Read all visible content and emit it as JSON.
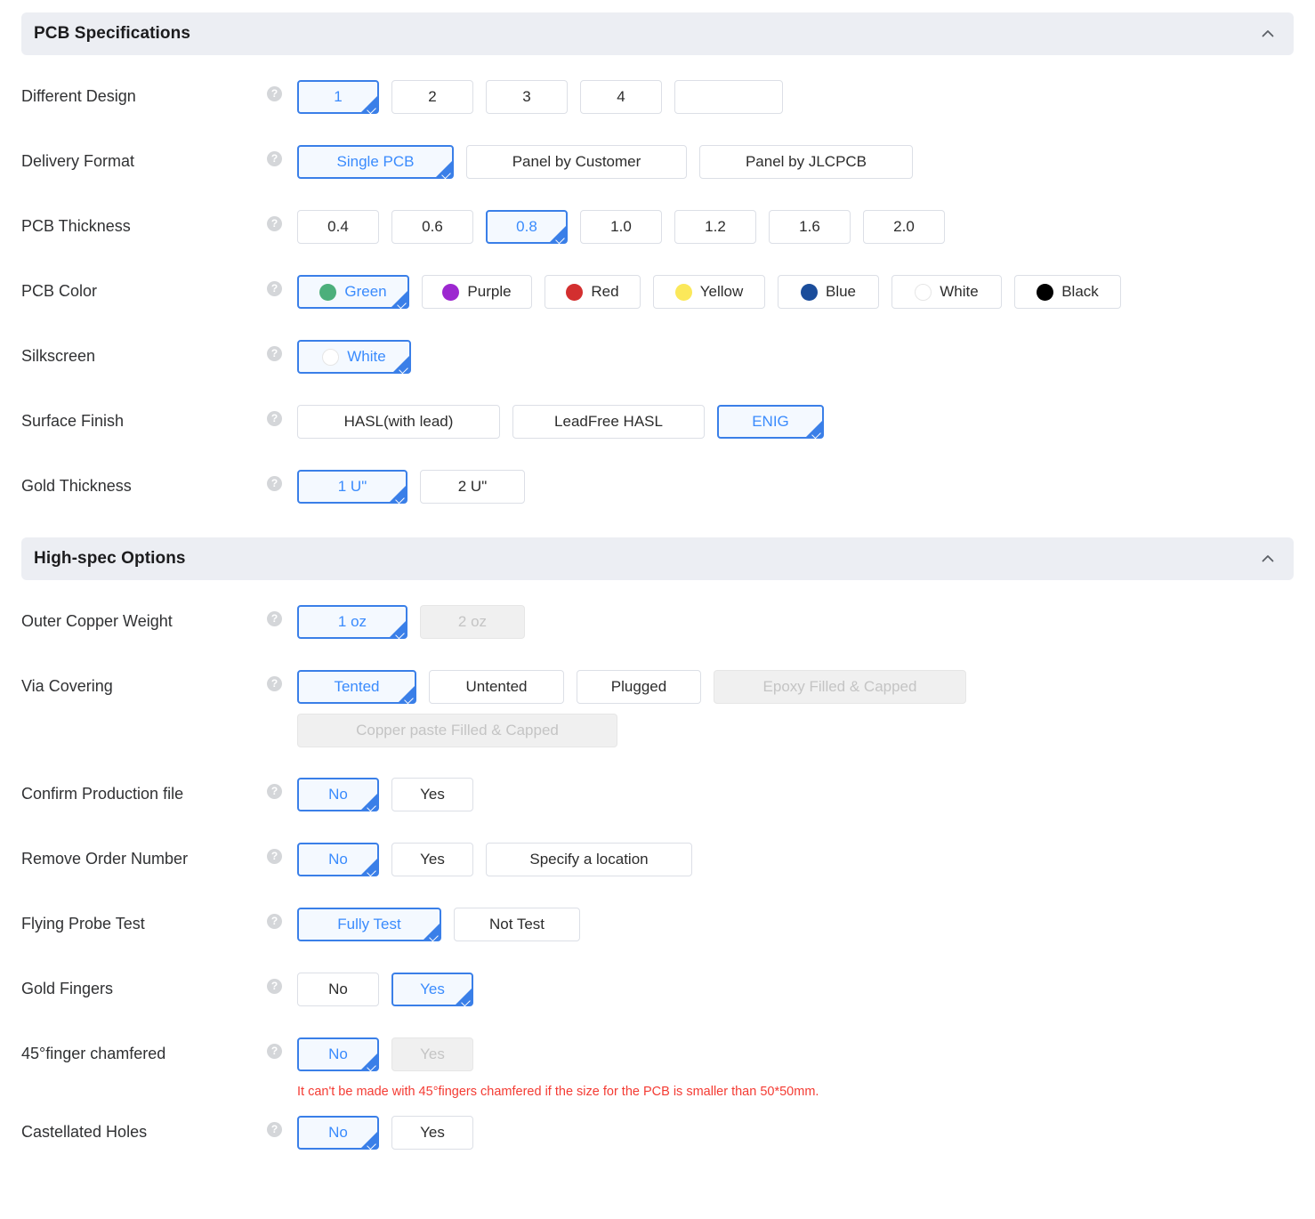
{
  "sections": [
    {
      "title": "PCB Specifications",
      "collapse_icon": "chevron-up-icon"
    },
    {
      "title": "High-spec Options",
      "collapse_icon": "chevron-up-icon"
    }
  ],
  "help_icon_glyph": "?",
  "colors": {
    "accent": "#3a8bfd",
    "accent_border": "#3a7fe8",
    "selected_bg": "#f4f9ff",
    "header_bg": "#eceef3",
    "warning": "#f43b33",
    "disabled_bg": "#f0f0f0",
    "disabled_text": "#c4c4c4",
    "swatch_green": "#4caf7b",
    "swatch_purple": "#9c27d0",
    "swatch_red": "#d32f2f",
    "swatch_yellow": "#fbe85a",
    "swatch_blue": "#1b4d9b",
    "swatch_white": "#ffffff",
    "swatch_black": "#000000"
  },
  "pcb_specifications": {
    "different_design": {
      "label": "Different Design",
      "options": [
        "1",
        "2",
        "3",
        "4"
      ],
      "selected": "1",
      "custom_input_value": "",
      "custom_input_placeholder": ""
    },
    "delivery_format": {
      "label": "Delivery Format",
      "options": [
        "Single PCB",
        "Panel by Customer",
        "Panel by JLCPCB"
      ],
      "selected": "Single PCB"
    },
    "pcb_thickness": {
      "label": "PCB Thickness",
      "options": [
        "0.4",
        "0.6",
        "0.8",
        "1.0",
        "1.2",
        "1.6",
        "2.0"
      ],
      "selected": "0.8"
    },
    "pcb_color": {
      "label": "PCB Color",
      "options": [
        {
          "label": "Green",
          "swatch": "#4caf7b"
        },
        {
          "label": "Purple",
          "swatch": "#9c27d0"
        },
        {
          "label": "Red",
          "swatch": "#d32f2f"
        },
        {
          "label": "Yellow",
          "swatch": "#fbe85a"
        },
        {
          "label": "Blue",
          "swatch": "#1b4d9b"
        },
        {
          "label": "White",
          "swatch": "#ffffff"
        },
        {
          "label": "Black",
          "swatch": "#000000"
        }
      ],
      "selected": "Green"
    },
    "silkscreen": {
      "label": "Silkscreen",
      "options": [
        {
          "label": "White",
          "swatch": "#ffffff"
        }
      ],
      "selected": "White"
    },
    "surface_finish": {
      "label": "Surface Finish",
      "options": [
        "HASL(with lead)",
        "LeadFree HASL",
        "ENIG"
      ],
      "selected": "ENIG"
    },
    "gold_thickness": {
      "label": "Gold Thickness",
      "options": [
        "1 U\"",
        "2 U\""
      ],
      "selected": "1 U\""
    }
  },
  "high_spec_options": {
    "outer_copper_weight": {
      "label": "Outer Copper Weight",
      "options": [
        "1 oz",
        "2 oz"
      ],
      "selected": "1 oz",
      "disabled": [
        "2 oz"
      ]
    },
    "via_covering": {
      "label": "Via Covering",
      "options": [
        "Tented",
        "Untented",
        "Plugged",
        "Epoxy Filled & Capped",
        "Copper paste Filled & Capped"
      ],
      "selected": "Tented",
      "disabled": [
        "Epoxy Filled & Capped",
        "Copper paste Filled & Capped"
      ]
    },
    "confirm_production_file": {
      "label": "Confirm Production file",
      "options": [
        "No",
        "Yes"
      ],
      "selected": "No"
    },
    "remove_order_number": {
      "label": "Remove Order Number",
      "options": [
        "No",
        "Yes",
        "Specify a location"
      ],
      "selected": "No"
    },
    "flying_probe_test": {
      "label": "Flying Probe Test",
      "options": [
        "Fully Test",
        "Not Test"
      ],
      "selected": "Fully Test"
    },
    "gold_fingers": {
      "label": "Gold Fingers",
      "options": [
        "No",
        "Yes"
      ],
      "selected": "Yes"
    },
    "finger_chamfered": {
      "label": "45°finger chamfered",
      "options": [
        "No",
        "Yes"
      ],
      "selected": "No",
      "disabled": [
        "Yes"
      ],
      "warning": "It can't be made with 45°fingers chamfered if the size for the PCB is smaller than 50*50mm."
    },
    "castellated_holes": {
      "label": "Castellated Holes",
      "options": [
        "No",
        "Yes"
      ],
      "selected": "No"
    }
  }
}
